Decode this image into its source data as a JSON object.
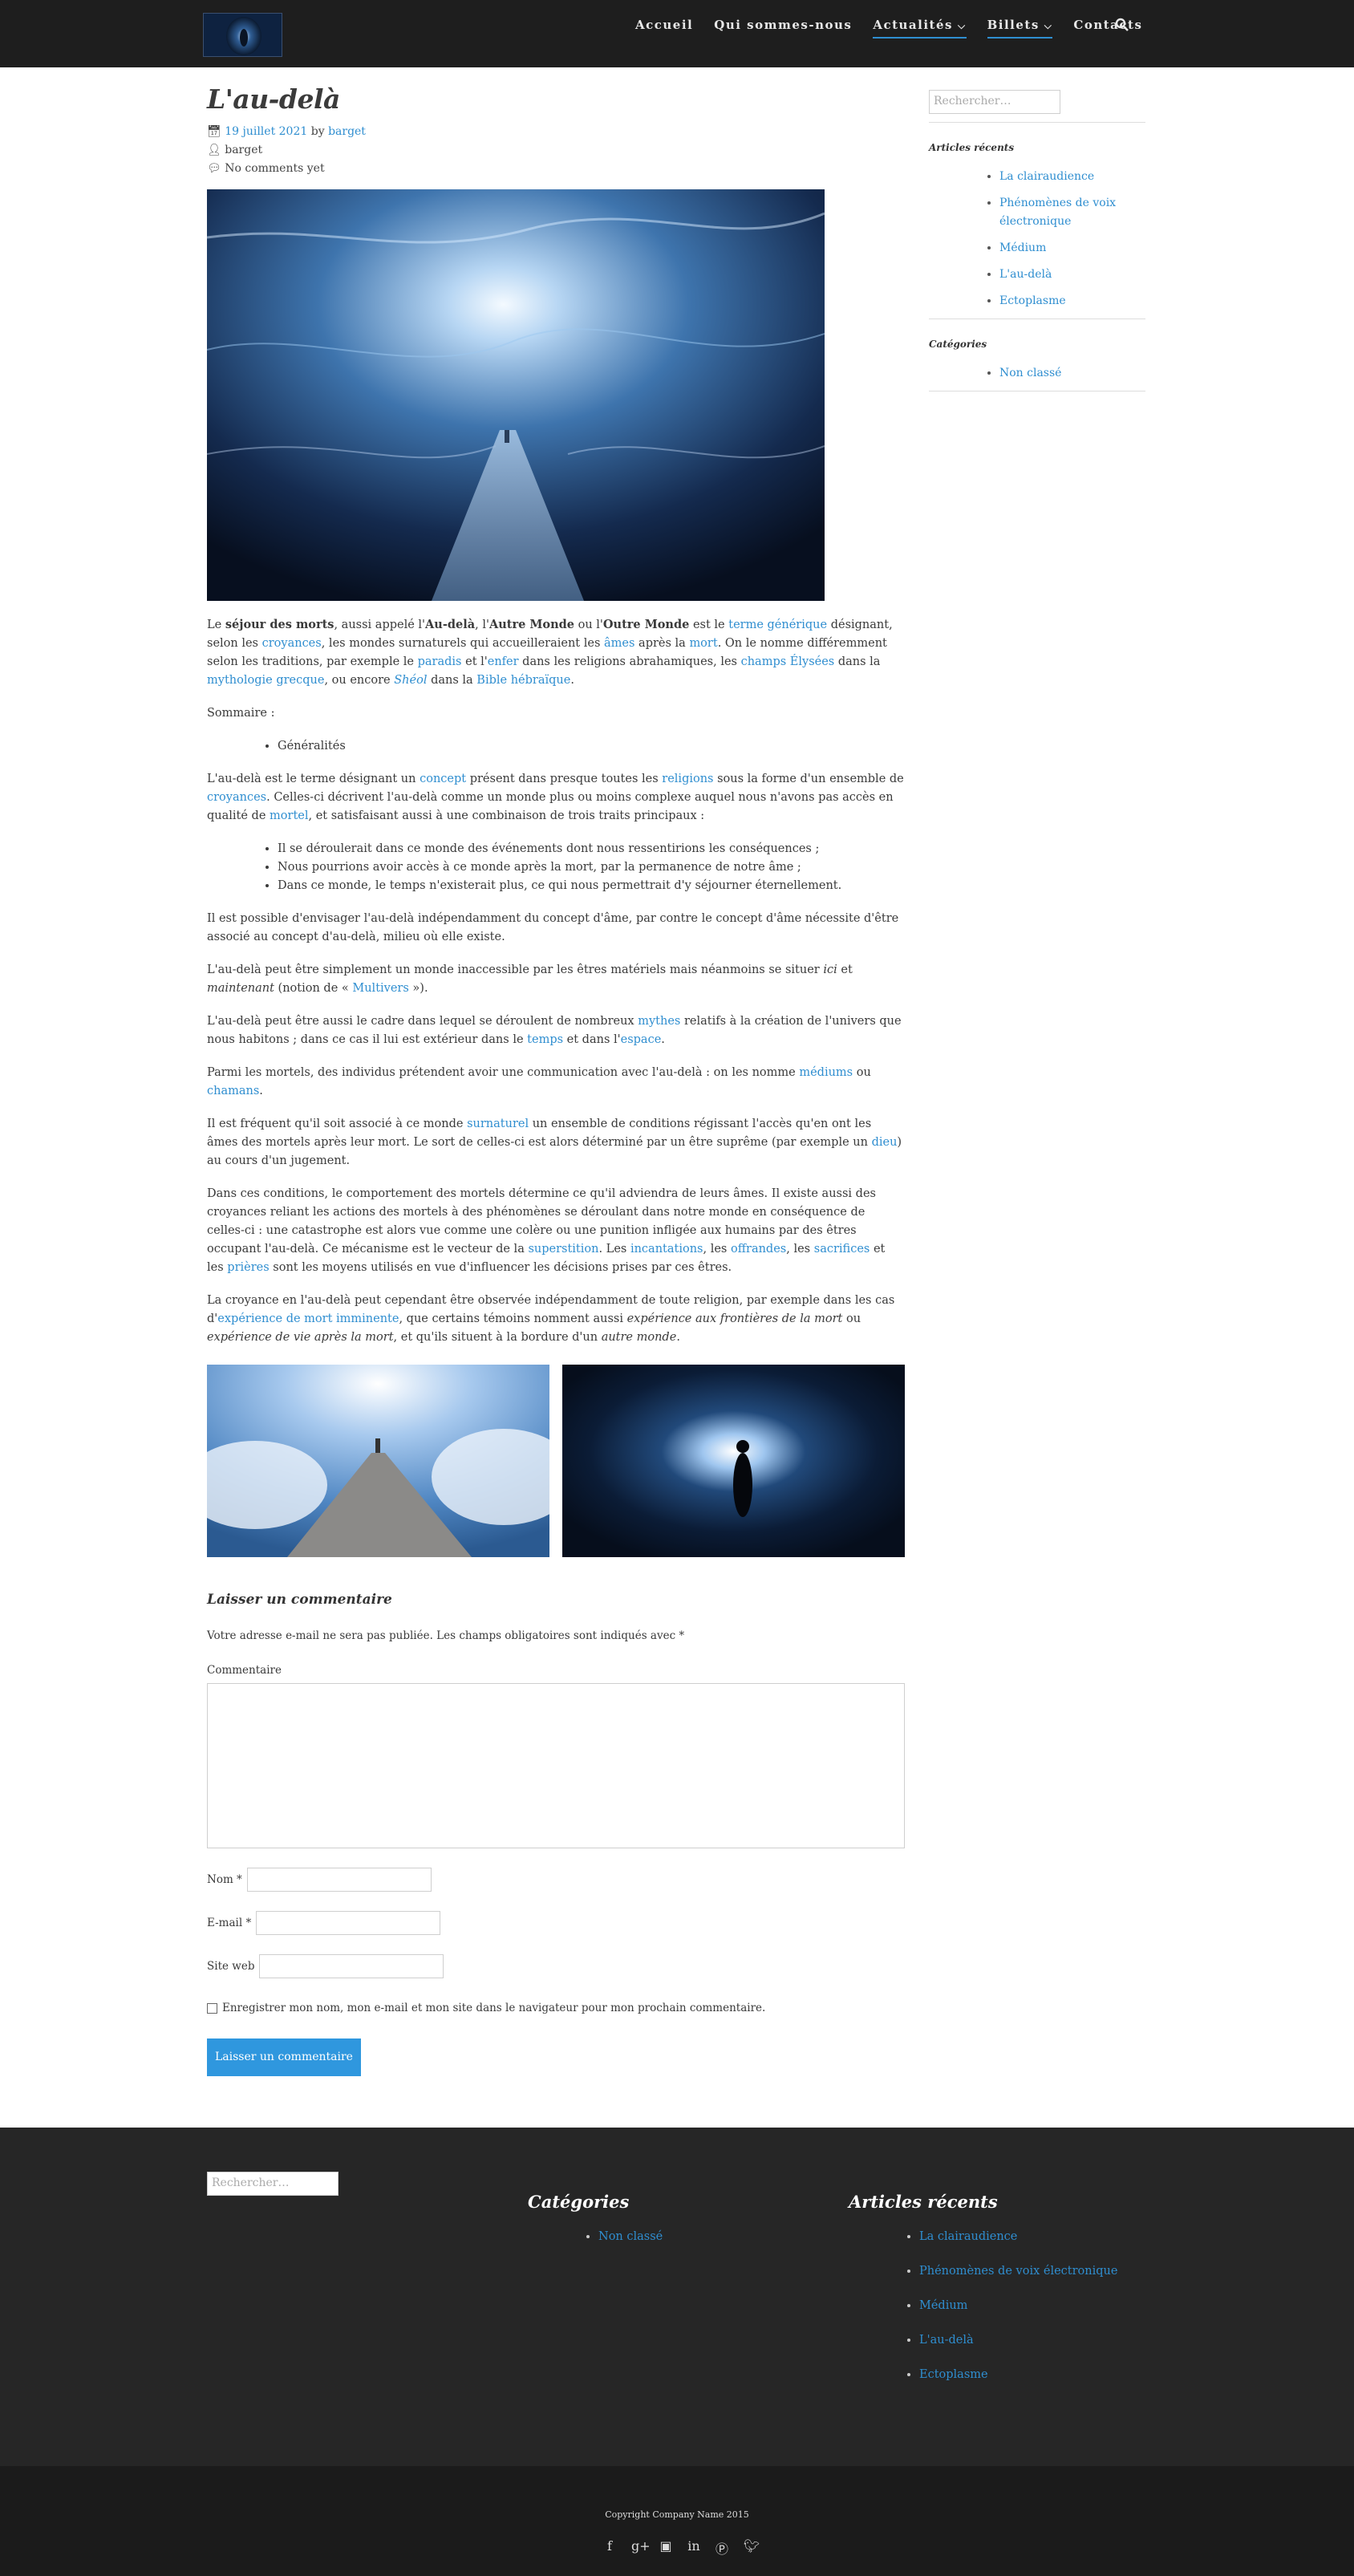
{
  "nav": {
    "logo": "site-logo",
    "items": [
      {
        "label": "Accueil",
        "underline": false,
        "chevron": false
      },
      {
        "label": "Qui sommes-nous",
        "underline": false,
        "chevron": false
      },
      {
        "label": "Actualités",
        "underline": true,
        "chevron": true
      },
      {
        "label": "Billets",
        "underline": true,
        "chevron": true
      },
      {
        "label": "Contacts",
        "underline": false,
        "chevron": false
      }
    ],
    "search_icon": "search-icon"
  },
  "post": {
    "title": "L'au-delà",
    "date": "19 juillet 2021",
    "by": "by",
    "author": "barget",
    "author_line": "barget",
    "comments": "No comments yet",
    "p1": [
      {
        "t": "Le "
      },
      {
        "t": "séjour des morts",
        "b": true
      },
      {
        "t": ", aussi appelé l'"
      },
      {
        "t": "Au-delà",
        "b": true
      },
      {
        "t": ", l'"
      },
      {
        "t": "Autre Monde",
        "b": true
      },
      {
        "t": " ou l'"
      },
      {
        "t": "Outre Monde",
        "b": true
      },
      {
        "t": " est le "
      },
      {
        "t": "terme générique",
        "a": true
      },
      {
        "t": " désignant, selon les "
      },
      {
        "t": "croyances",
        "a": true
      },
      {
        "t": ", les mondes surnaturels qui accueilleraient les "
      },
      {
        "t": "âmes",
        "a": true
      },
      {
        "t": " après la "
      },
      {
        "t": "mort",
        "a": true
      },
      {
        "t": ". On le nomme différemment selon les traditions, par exemple le "
      },
      {
        "t": "paradis",
        "a": true
      },
      {
        "t": " et l'"
      },
      {
        "t": "enfer",
        "a": true
      },
      {
        "t": " dans les religions abrahamiques, les "
      },
      {
        "t": "champs Élysées",
        "a": true
      },
      {
        "t": " dans la "
      },
      {
        "t": "mythologie grecque",
        "a": true
      },
      {
        "t": ", ou encore "
      },
      {
        "t": "Shéol",
        "a": true,
        "i": true
      },
      {
        "t": " dans la "
      },
      {
        "t": "Bible hébraïque",
        "a": true
      },
      {
        "t": "."
      }
    ],
    "summary_label": "Sommaire :",
    "summary_items": [
      "Généralités"
    ],
    "p2": [
      {
        "t": "L'au-delà est le terme désignant un "
      },
      {
        "t": "concept",
        "a": true
      },
      {
        "t": " présent dans presque toutes les "
      },
      {
        "t": "religions",
        "a": true
      },
      {
        "t": " sous la forme d'un ensemble de "
      },
      {
        "t": "croyances",
        "a": true
      },
      {
        "t": ". Celles-ci décrivent l'au-delà comme un monde plus ou moins complexe auquel nous n'avons pas accès en qualité de "
      },
      {
        "t": "mortel",
        "a": true
      },
      {
        "t": ", et satisfaisant aussi à une combinaison de trois traits principaux :"
      }
    ],
    "traits": [
      "Il se déroulerait dans ce monde des événements dont nous ressentirions les conséquences ;",
      "Nous pourrions avoir accès à ce monde après la mort, par la permanence de notre âme ;",
      "Dans ce monde, le temps n'existerait plus, ce qui nous permettrait d'y séjourner éternellement."
    ],
    "p3": [
      {
        "t": "Il est possible d'envisager l'au-delà indépendamment du concept d'âme, par contre le concept d'âme nécessite d'être associé au concept d'au-delà, milieu où elle existe."
      }
    ],
    "p4": [
      {
        "t": "L'au-delà peut être simplement un monde inaccessible par les êtres matériels mais néanmoins se situer "
      },
      {
        "t": "ici",
        "i": true
      },
      {
        "t": " et "
      },
      {
        "t": "maintenant",
        "i": true
      },
      {
        "t": " (notion de « "
      },
      {
        "t": "Multivers",
        "a": true
      },
      {
        "t": " »)."
      }
    ],
    "p5": [
      {
        "t": "L'au-delà peut être aussi le cadre dans lequel se déroulent de nombreux "
      },
      {
        "t": "mythes",
        "a": true
      },
      {
        "t": " relatifs à la création de l'univers que nous habitons ; dans ce cas il lui est extérieur dans le "
      },
      {
        "t": "temps",
        "a": true
      },
      {
        "t": " et dans l'"
      },
      {
        "t": "espace",
        "a": true
      },
      {
        "t": "."
      }
    ],
    "p6": [
      {
        "t": "Parmi les mortels, des individus prétendent avoir une communication avec l'au-delà : on les nomme "
      },
      {
        "t": "médiums",
        "a": true
      },
      {
        "t": " ou "
      },
      {
        "t": "chamans",
        "a": true
      },
      {
        "t": "."
      }
    ],
    "p7": [
      {
        "t": "Il est fréquent qu'il soit associé à ce monde "
      },
      {
        "t": "surnaturel",
        "a": true
      },
      {
        "t": " un ensemble de conditions régissant l'accès qu'en ont les âmes des mortels après leur mort. Le sort de celles-ci est alors déterminé par un être suprême (par exemple un "
      },
      {
        "t": "dieu",
        "a": true
      },
      {
        "t": ") au cours d'un jugement."
      }
    ],
    "p8": [
      {
        "t": "Dans ces conditions, le comportement des mortels détermine ce qu'il adviendra de leurs âmes. Il existe aussi des croyances reliant les actions des mortels à des phénomènes se déroulant dans notre monde en conséquence de celles-ci : une catastrophe est alors vue comme une colère ou une punition infligée aux humains par des êtres occupant l'au-delà. Ce mécanisme est le vecteur de la "
      },
      {
        "t": "superstition",
        "a": true
      },
      {
        "t": ". Les "
      },
      {
        "t": "incantations",
        "a": true
      },
      {
        "t": ", les "
      },
      {
        "t": "offrandes",
        "a": true
      },
      {
        "t": ", les "
      },
      {
        "t": "sacrifices",
        "a": true
      },
      {
        "t": " et les "
      },
      {
        "t": "prières",
        "a": true
      },
      {
        "t": " sont les moyens utilisés en vue d'influencer les décisions prises par ces êtres."
      }
    ],
    "p9": [
      {
        "t": "La croyance en l'au-delà peut cependant être observée indépendamment de toute religion, par exemple dans les cas d'"
      },
      {
        "t": "expérience de mort imminente",
        "a": true
      },
      {
        "t": ", que certains témoins nomment aussi "
      },
      {
        "t": "expérience aux frontières de la mort",
        "i": true
      },
      {
        "t": " ou "
      },
      {
        "t": "expérience de vie après la mort",
        "i": true
      },
      {
        "t": ", et qu'ils situent à la bordure d'un "
      },
      {
        "t": "autre monde",
        "i": true
      },
      {
        "t": "."
      }
    ]
  },
  "comment_form": {
    "title": "Laisser un commentaire",
    "note": "Votre adresse e-mail ne sera pas publiée. Les champs obligatoires sont indiqués avec *",
    "comment_label": "Commentaire",
    "name_label": "Nom *",
    "email_label": "E-mail *",
    "website_label": "Site web",
    "save_label": "Enregistrer mon nom, mon e-mail et mon site dans le navigateur pour mon prochain commentaire.",
    "submit_label": "Laisser un commentaire"
  },
  "sidebar": {
    "search_placeholder": "Rechercher…",
    "recent_title": "Articles récents",
    "recent": [
      "La clairaudience",
      "Phénomènes de voix électronique",
      "Médium",
      "L'au-delà",
      "Ectoplasme"
    ],
    "categories_title": "Catégories",
    "categories": [
      "Non classé"
    ]
  },
  "footer": {
    "search_placeholder": "Rechercher…",
    "categories_title": "Catégories",
    "categories": [
      "Non classé"
    ],
    "recent_title": "Articles récents",
    "recent": [
      "La clairaudience",
      "Phénomènes de voix électronique",
      "Médium",
      "L'au-delà",
      "Ectoplasme"
    ],
    "copyright": "Copyright Company Name 2015",
    "social": [
      "facebook-icon",
      "google-plus-icon",
      "instagram-icon",
      "linkedin-icon",
      "pinterest-icon",
      "twitter-icon"
    ]
  },
  "colors": {
    "link": "#2f8ed0",
    "nav_bg": "#1e1e1e",
    "footer_bg": "#262626",
    "bottom_bg": "#1b1b1b",
    "button": "#2f97de"
  }
}
